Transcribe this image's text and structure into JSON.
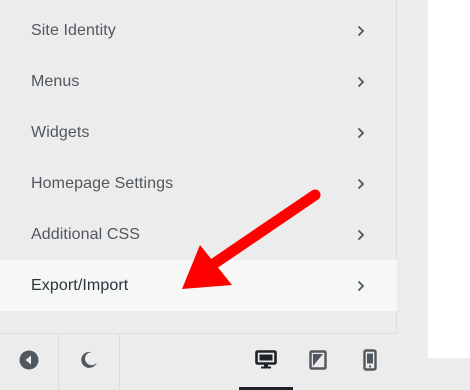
{
  "menu": {
    "items": [
      {
        "label": "Site Identity",
        "active": false
      },
      {
        "label": "Menus",
        "active": false
      },
      {
        "label": "Widgets",
        "active": false
      },
      {
        "label": "Homepage Settings",
        "active": false
      },
      {
        "label": "Additional CSS",
        "active": false
      },
      {
        "label": "Export/Import",
        "active": true
      }
    ]
  },
  "footer": {
    "buttons": [
      "back-icon",
      "dark-mode-icon"
    ],
    "devices": [
      "desktop-icon",
      "tablet-icon",
      "mobile-icon"
    ],
    "active_device": "desktop"
  },
  "colors": {
    "panel_bg": "#ececec",
    "active_item_bg": "#f6f7f7",
    "text": "#50575e",
    "annotation_arrow": "#ff0000"
  }
}
